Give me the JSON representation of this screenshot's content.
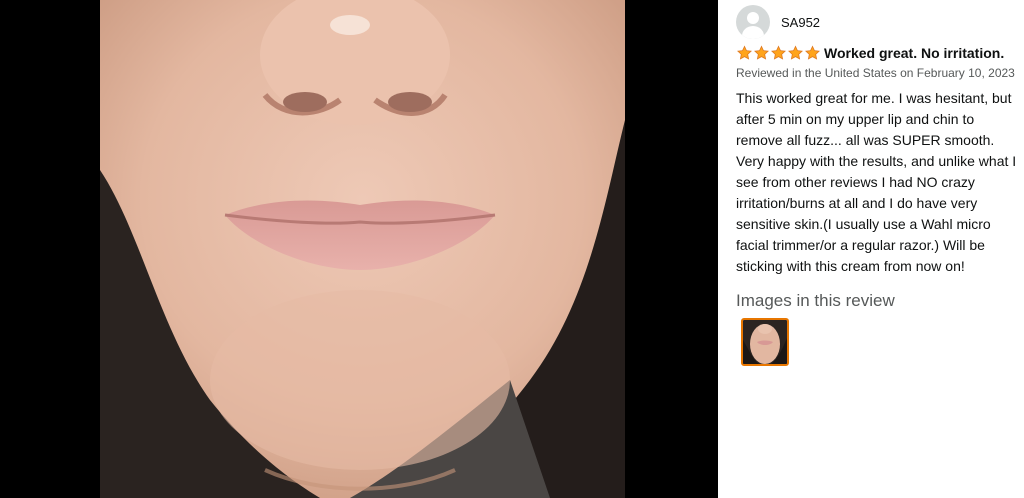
{
  "review": {
    "author": "SA952",
    "rating_stars": 5,
    "title": "Worked great. No irritation.",
    "meta": "Reviewed in the United States on February 10, 2023",
    "body": "This worked great for me. I was hesitant, but after 5 min on my upper lip and chin to remove all fuzz... all was SUPER smooth. Very happy with the results, and unlike what I see from other reviews I had NO crazy irritation/burns at all and I do have very sensitive skin.(I usually use a Wahl micro facial trimmer/or a regular razor.) Will be sticking with this cream from now on!",
    "images_heading": "Images in this review",
    "thumbnail_count": 1
  },
  "colors": {
    "star_fill": "#FFA41C",
    "star_stroke": "#DE7921",
    "thumb_border": "#E77600",
    "meta_text": "#565959",
    "body_text": "#0F1111"
  },
  "icons": {
    "avatar": "default-profile-avatar-icon",
    "star": "star-icon"
  }
}
